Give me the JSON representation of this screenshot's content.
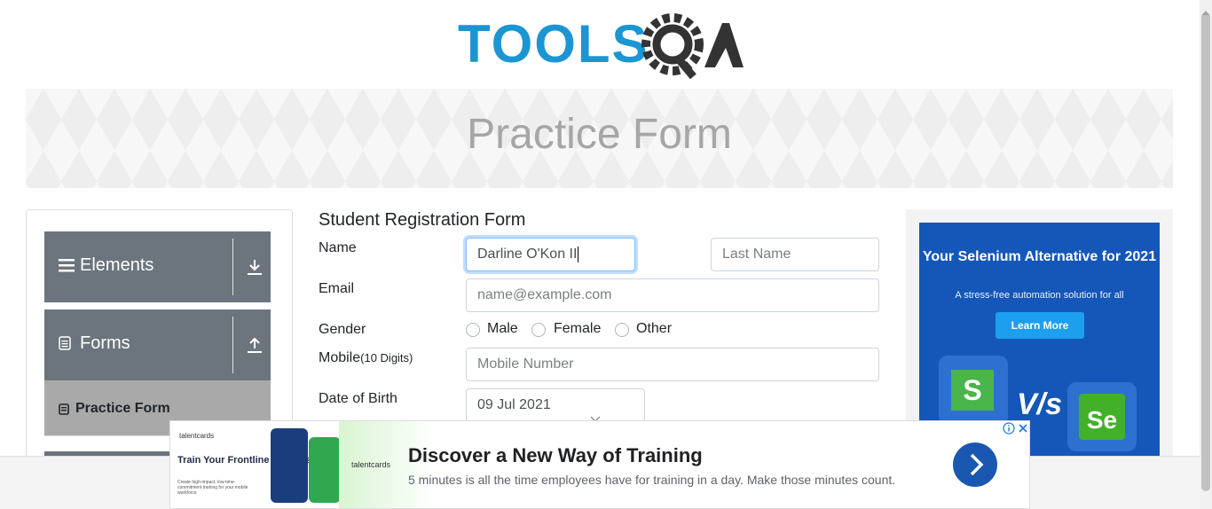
{
  "header": {
    "logo_text": "TOOLSQA"
  },
  "banner": {
    "title": "Practice Form"
  },
  "sidebar": {
    "groups": [
      {
        "label": "Elements",
        "toggle_icon": "download-icon"
      },
      {
        "label": "Forms",
        "toggle_icon": "upload-icon"
      }
    ],
    "active_item": {
      "label": "Practice Form"
    }
  },
  "form": {
    "title": "Student Registration Form",
    "name_label": "Name",
    "first_name_value": "Darline O'Kon II",
    "last_name_placeholder": "Last Name",
    "email_label": "Email",
    "email_placeholder": "name@example.com",
    "gender_label": "Gender",
    "gender_options": [
      "Male",
      "Female",
      "Other"
    ],
    "mobile_label": "Mobile",
    "mobile_hint": "(10 Digits)",
    "mobile_placeholder": "Mobile Number",
    "dob_label": "Date of Birth",
    "dob_value": "09 Jul 2021"
  },
  "side_ad": {
    "headline": "Your Selenium Alternative for 2021",
    "subtext": "A stress-free automation solution for all",
    "button_label": "Learn More",
    "vs_text": "V/s",
    "s_letter": "S",
    "se_letter": "Se"
  },
  "bottom_ad": {
    "brand": "talentcards",
    "left_title": "Train Your Frontline Workers",
    "left_small": "Create high-impact, low-time-commitment training for your mobile workforce",
    "title": "Discover a New Way of Training",
    "description": "5 minutes is all the time employees have for training in a day. Make those minutes count."
  },
  "colors": {
    "logo_blue": "#1b96d3",
    "logo_dark": "#333333",
    "sidebar_group": "#6c757d",
    "active_item": "#a9a9a9",
    "ad_blue": "#1557b8",
    "focus_border": "#80bdff"
  }
}
